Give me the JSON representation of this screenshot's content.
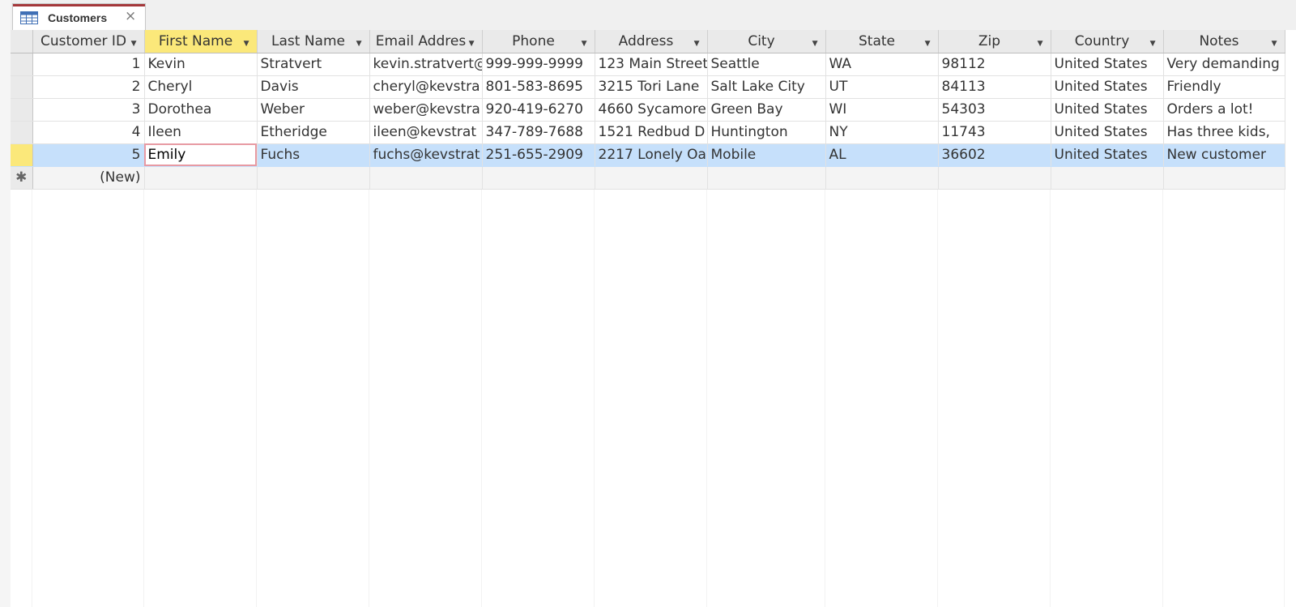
{
  "document_tab": {
    "title": "Customers",
    "close_glyph": "×",
    "icon": "table-icon"
  },
  "columns": [
    {
      "label": "Customer ID"
    },
    {
      "label": "First Name"
    },
    {
      "label": "Last Name"
    },
    {
      "label": "Email Addres"
    },
    {
      "label": "Phone"
    },
    {
      "label": "Address"
    },
    {
      "label": "City"
    },
    {
      "label": "State"
    },
    {
      "label": "Zip"
    },
    {
      "label": "Country"
    },
    {
      "label": "Notes"
    }
  ],
  "sort_glyph": "▼",
  "rows": [
    [
      "1",
      "Kevin",
      "Stratvert",
      "kevin.stratvert@",
      "999-999-9999",
      "123 Main Street",
      "Seattle",
      "WA",
      "98112",
      "United States",
      "Very demanding"
    ],
    [
      "2",
      "Cheryl",
      "Davis",
      "cheryl@kevstra",
      "801-583-8695",
      "3215 Tori Lane",
      "Salt Lake City",
      "UT",
      "84113",
      "United States",
      "Friendly"
    ],
    [
      "3",
      "Dorothea",
      "Weber",
      "weber@kevstra",
      "920-419-6270",
      "4660 Sycamore",
      "Green Bay",
      "WI",
      "54303",
      "United States",
      "Orders a lot!"
    ],
    [
      "4",
      "Ileen",
      "Etheridge",
      "ileen@kevstrat",
      "347-789-7688",
      "1521 Redbud D",
      "Huntington",
      "NY",
      "11743",
      "United States",
      "Has three kids,"
    ],
    [
      "5",
      "Emily",
      "Fuchs",
      "fuchs@kevstrat",
      "251-655-2909",
      "2217 Lonely Oa",
      "Mobile",
      "AL",
      "36602",
      "United States",
      "New customer"
    ]
  ],
  "new_row": {
    "marker": "✱",
    "label": "(New)"
  },
  "active_row": 4,
  "active_column": 1,
  "colors": {
    "active_header": "#fbe87a",
    "selected_row": "#c6e0fb",
    "tab_accent": "#a4373a"
  }
}
